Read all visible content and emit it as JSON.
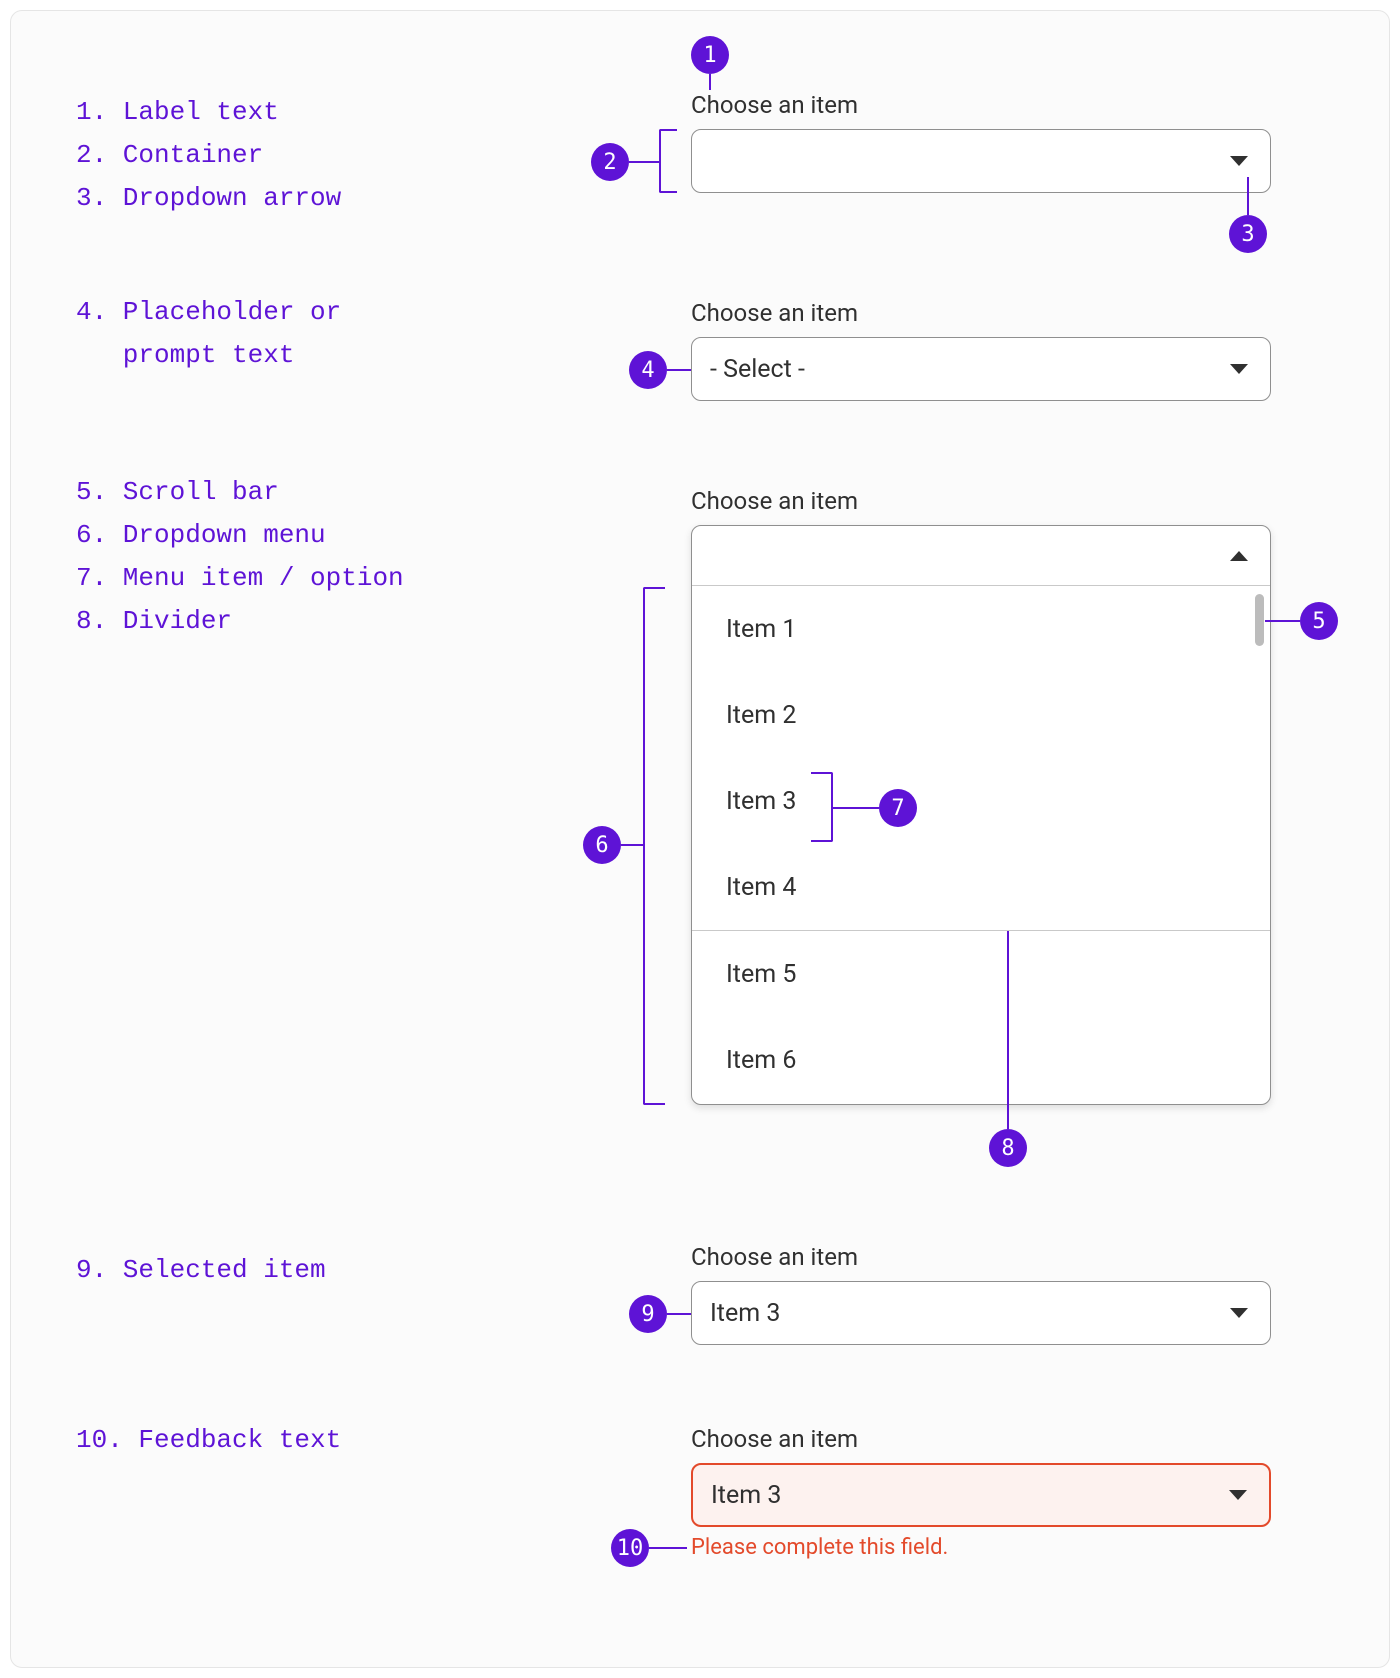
{
  "legend": {
    "g1": "1. Label text\n2. Container\n3. Dropdown arrow",
    "g2": "4. Placeholder or\n   prompt text",
    "g3": "5. Scroll bar\n6. Dropdown menu\n7. Menu item / option\n8. Divider",
    "g4": "9. Selected item",
    "g5": "10. Feedback text"
  },
  "labels": {
    "choose": "Choose an item"
  },
  "examples": {
    "ex1": {
      "value": ""
    },
    "ex2": {
      "placeholder": "- Select -"
    },
    "ex3": {
      "options": [
        "Item 1",
        "Item 2",
        "Item 3",
        "Item 4",
        "Item 5",
        "Item 6"
      ]
    },
    "ex4": {
      "value": "Item 3"
    },
    "ex5": {
      "value": "Item 3",
      "feedback": "Please complete this field."
    }
  },
  "badges": {
    "b1": "1",
    "b2": "2",
    "b3": "3",
    "b4": "4",
    "b5": "5",
    "b6": "6",
    "b7": "7",
    "b8": "8",
    "b9": "9",
    "b10": "10"
  }
}
